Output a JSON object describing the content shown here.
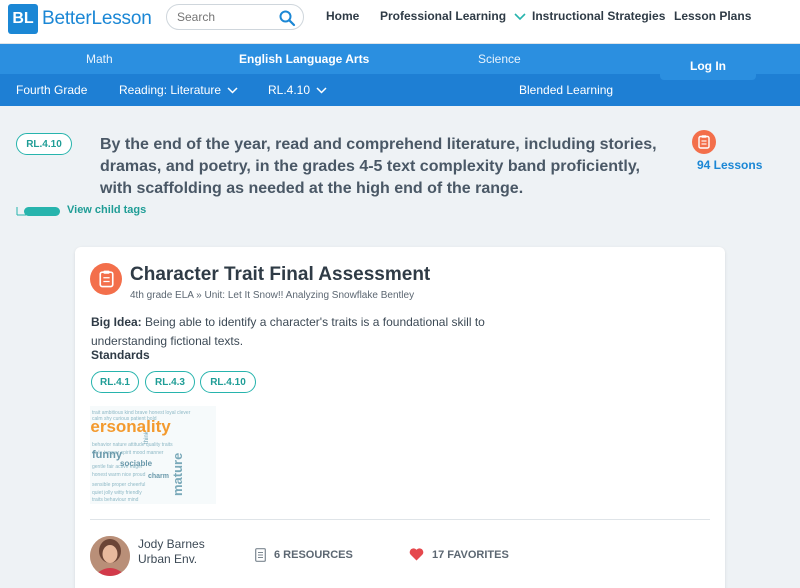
{
  "brand": {
    "logo_mark": "BL",
    "name": "BetterLesson"
  },
  "search": {
    "placeholder": "Search",
    "icon": "search-icon"
  },
  "top_nav": {
    "home": "Home",
    "professional_learning": "Professional Learning",
    "instructional_strategies": "Instructional Strategies",
    "lesson_plans": "Lesson Plans"
  },
  "subjects": {
    "math": "Math",
    "ela": "English Language Arts",
    "science": "Science"
  },
  "login": "Log In",
  "breadcrumb": {
    "grade": "Fourth Grade",
    "strand": "Reading: Literature",
    "standard": "RL.4.10",
    "blended": "Blended Learning"
  },
  "standard": {
    "tag": "RL.4.10",
    "description": "By the end of the year, read and comprehend literature, including stories, dramas, and poetry, in the grades 4-5 text complexity band proficiently, with scaffolding as needed at the high end of the range.",
    "lessons_count": "94 Lessons",
    "child_tags_link": "View child tags"
  },
  "lesson_card": {
    "title": "Character Trait Final Assessment",
    "subtitle": "4th grade ELA » Unit: Let It Snow!! Analyzing Snowflake Bentley",
    "big_idea_label": "Big Idea:",
    "big_idea": "Being able to identify a character's traits is a foundational skill to understanding fictional texts.",
    "standards_label": "Standards",
    "standards": [
      "RL.4.1",
      "RL.4.3",
      "RL.4.10"
    ],
    "thumbnail_word": "personality",
    "author_name": "Jody Barnes",
    "author_school": "Urban Env.",
    "resources": "6 RESOURCES",
    "favorites": "17 FAVORITES"
  },
  "colors": {
    "brand_blue": "#1b87d5",
    "teal": "#27b4ad",
    "orange": "#f36f4b",
    "heart": "#e5484d"
  }
}
